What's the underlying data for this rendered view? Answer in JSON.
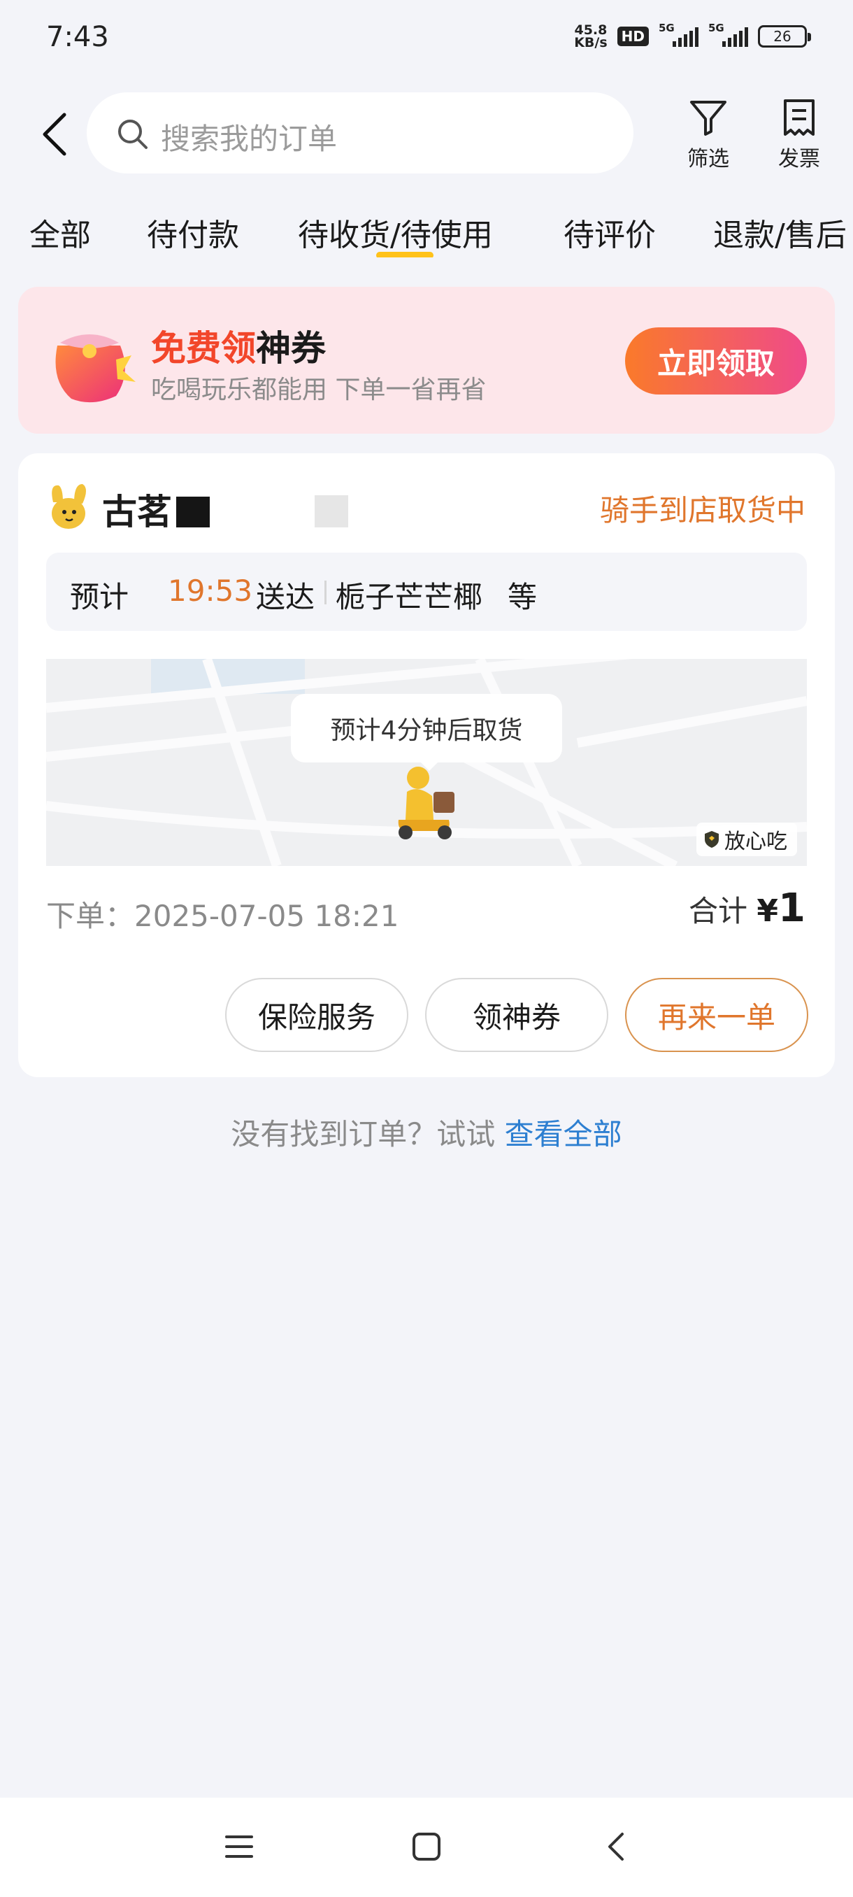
{
  "status_bar": {
    "time": "7:43",
    "net_speed_value": "45.8",
    "net_speed_unit": "KB/s",
    "hd_label": "HD",
    "sig1_label": "5G",
    "sig2_label": "5G",
    "battery": "26"
  },
  "header": {
    "search_placeholder": "搜索我的订单",
    "filter_label": "筛选",
    "invoice_label": "发票"
  },
  "tabs": [
    {
      "label": "全部"
    },
    {
      "label": "待付款"
    },
    {
      "label": "待收货/待使用",
      "active": true
    },
    {
      "label": "待评价"
    },
    {
      "label": "退款/售后"
    }
  ],
  "promo": {
    "title_highlight": "免费领",
    "title_rest": "神券",
    "subtitle": "吃喝玩乐都能用 下单一省再省",
    "button": "立即领取"
  },
  "order": {
    "store_name": "古茗",
    "status": "骑手到店取货中",
    "eta_prefix": "预计",
    "eta_time": "19:53",
    "eta_suffix": "送达",
    "items": "栀子芒芒椰",
    "items_suffix": "等",
    "map_bubble": "预计4分钟后取货",
    "map_badge": "放心吃",
    "order_time_label": "下单：",
    "order_time": "2025-07-05 18:21",
    "total_label": "合计",
    "total_currency": "¥",
    "total_amount": "1",
    "actions": [
      "保险服务",
      "领神券",
      "再来一单"
    ]
  },
  "footer": {
    "not_found": "没有找到订单？试试",
    "view_all": "查看全部"
  },
  "colors": {
    "accent_orange": "#e0762c",
    "tab_indicator": "#ffc21a",
    "link_blue": "#2d7fd1",
    "promo_red": "#f2462a"
  }
}
